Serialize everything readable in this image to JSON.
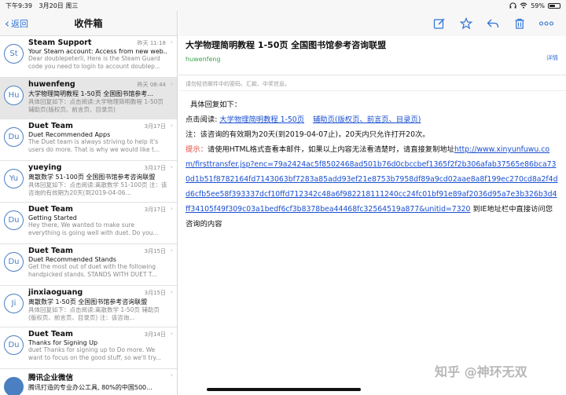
{
  "status": {
    "time": "下午9:39",
    "date": "3月20日 周三",
    "battery": "59%",
    "battery_level": 0.59
  },
  "list": {
    "back_label": "返回",
    "title": "收件箱",
    "items": [
      {
        "initials": "St",
        "sender": "Steam Support",
        "date": "昨天 11:18",
        "subject": "Your Steam account: Access from new web...",
        "preview": "Dear doublepeterli, Here is the Steam Guard code you need to login to account doublep...",
        "selected": false
      },
      {
        "initials": "Hu",
        "sender": "huwenfeng",
        "date": "昨天 08:44",
        "subject": "大学物理简明教程 1-50页 全国图书馆参考...",
        "preview": "具体回复如下：点击阅读:大学物理简明教程 1-50页 辅助页(版权页、前言页、目录页)",
        "selected": true
      },
      {
        "initials": "Du",
        "sender": "Duet Team",
        "date": "3月17日",
        "subject": "Duet Recommended Apps",
        "preview": "The Duet team is always striving to help it's users do more. That is why we would like t...",
        "selected": false
      },
      {
        "initials": "Yu",
        "sender": "yueying",
        "date": "3月17日",
        "subject": "离散数学 51-100页 全国图书馆参考咨询联盟",
        "preview": "具体回复如下：点击阅读:离散数学 51-100页 注：该咨询的有效期为20天(到2019-04-06...",
        "selected": false
      },
      {
        "initials": "Du",
        "sender": "Duet Team",
        "date": "3月17日",
        "subject": "Getting Started",
        "preview": "Hey there, We wanted to make sure everything is going well with duet. Do you...",
        "selected": false
      },
      {
        "initials": "Du",
        "sender": "Duet Team",
        "date": "3月15日",
        "subject": "Duet Recommended Stands",
        "preview": "Get the most out of duet with the following handpicked stands. STANDS WITH DUET T...",
        "selected": false
      },
      {
        "initials": "Ji",
        "sender": "jinxiaoguang",
        "date": "3月15日",
        "subject": "离散数学 1-50页 全国图书馆参考咨询联盟",
        "preview": "具体回复如下：点击阅读:离散数学 1-50页 辅助页(版权页、前言页、目录页) 注：该咨询...",
        "selected": false
      },
      {
        "initials": "Du",
        "sender": "Duet Team",
        "date": "3月14日",
        "subject": "Thanks for Signing Up",
        "preview": "duet Thanks for signing up to Do more. We want to focus on the good stuff, so we'll try...",
        "selected": false
      },
      {
        "initials": "",
        "sender": "腾讯企业微信",
        "date": "",
        "subject": "腾讯打造的专业办公工具, 80%的中国500...",
        "preview": "",
        "selected": false
      }
    ]
  },
  "email": {
    "subject": "大学物理简明教程 1-50页 全国图书馆参考咨询联盟",
    "from": "huwenfeng",
    "details_label": "详情",
    "notice": "请勿轻信邮件中的密码、汇款、中奖信息。",
    "body": {
      "intro": "具体回复如下：",
      "read_label": "点击阅读: ",
      "read_link": "大学物理简明教程 1-50页",
      "aux_link": "辅助页(版权页、前言页、目录页)",
      "note": "注：该咨询的有效期为20天(到2019-04-07止)，20天内只允许打开20次。",
      "tip_label": "提示：",
      "tip_text": "请使用HTML格式查看本邮件，如果以上内容无法看清楚时，请直接复制地址",
      "url": "http://www.xinyunfuwu.com/firsttransfer.jsp?enc=79a2424ac5f8502468ad501b76d0cbccbef1365f2f2b306afab37565e86bca730d1b51f8782164fd7143063bf7283a85add93ef21e8753b7958df89a9cd02aae8a8f199ec270cd8a2f4dd6cfb5ee58f393337dcf10ffd712342c48a6f982218111240cc24fc01bf91e89af2036d95a7e3b326b3d4ff34105f49f309c03a1bedf6cf3b8378bea44468fc32564519a877&unitid=7320",
      "url_suffix": "到IE地址栏中直接访问您咨询的内容"
    }
  },
  "watermark": "知乎 @神环无双"
}
